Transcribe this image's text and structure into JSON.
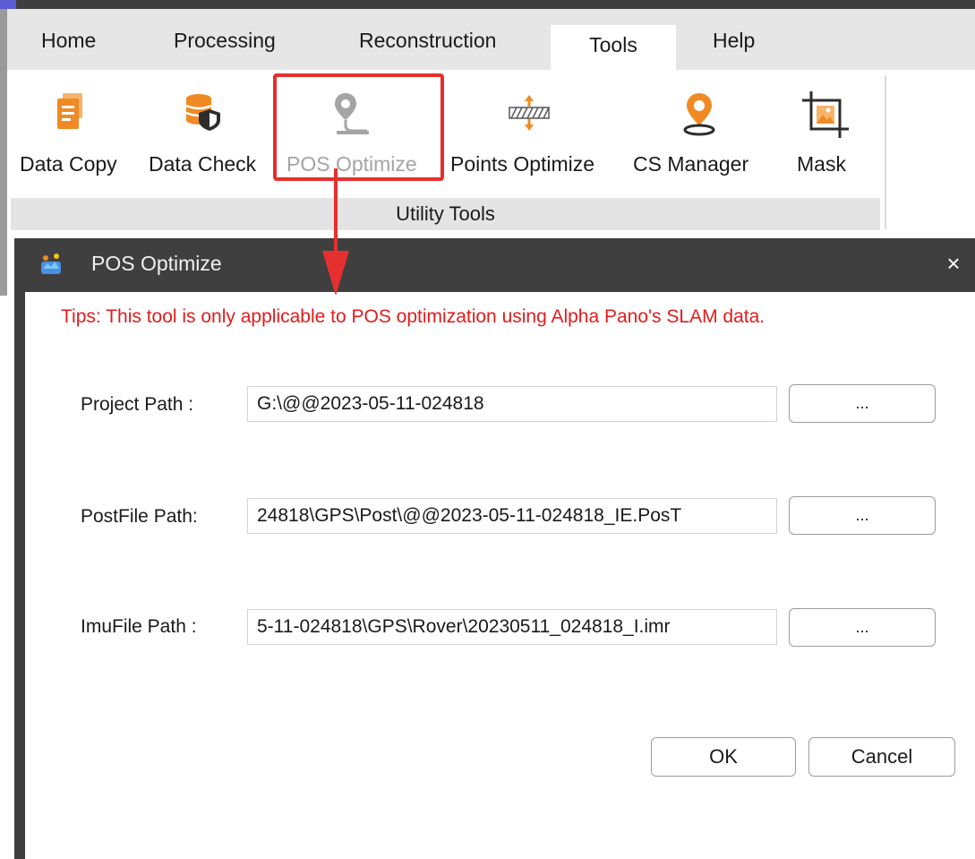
{
  "ribbon": {
    "tabs": [
      {
        "label": "Home"
      },
      {
        "label": "Processing"
      },
      {
        "label": "Reconstruction"
      },
      {
        "label": "Tools",
        "active": true
      },
      {
        "label": "Help"
      }
    ],
    "items": [
      {
        "label": "Data Copy",
        "icon": "data-copy-icon"
      },
      {
        "label": "Data Check",
        "icon": "data-check-icon"
      },
      {
        "label": "POS Optimize",
        "icon": "pos-optimize-icon",
        "disabled": true,
        "highlighted": true
      },
      {
        "label": "Points Optimize",
        "icon": "points-optimize-icon"
      },
      {
        "label": "CS Manager",
        "icon": "cs-manager-icon"
      },
      {
        "label": "Mask",
        "icon": "mask-icon"
      }
    ],
    "group_label": "Utility Tools"
  },
  "dialog": {
    "title": "POS Optimize",
    "close_label": "×",
    "tips": "Tips: This tool is only applicable to POS optimization using Alpha Pano's SLAM data.",
    "fields": [
      {
        "label": "Project Path :",
        "value": "G:\\@@2023-05-11-024818",
        "browse_label": "..."
      },
      {
        "label": "PostFile Path:",
        "value": "24818\\GPS\\Post\\@@2023-05-11-024818_IE.PosT",
        "browse_label": "..."
      },
      {
        "label": "ImuFile Path :",
        "value": "5-11-024818\\GPS\\Rover\\20230511_024818_I.imr",
        "browse_label": "..."
      }
    ],
    "ok_label": "OK",
    "cancel_label": "Cancel"
  },
  "colors": {
    "title_bar": "#3f3f3f",
    "tips_red": "#e31b1b",
    "highlight_red": "#e5302f",
    "icon_orange": "#f08a24",
    "icon_gray": "#a4a4a4"
  }
}
